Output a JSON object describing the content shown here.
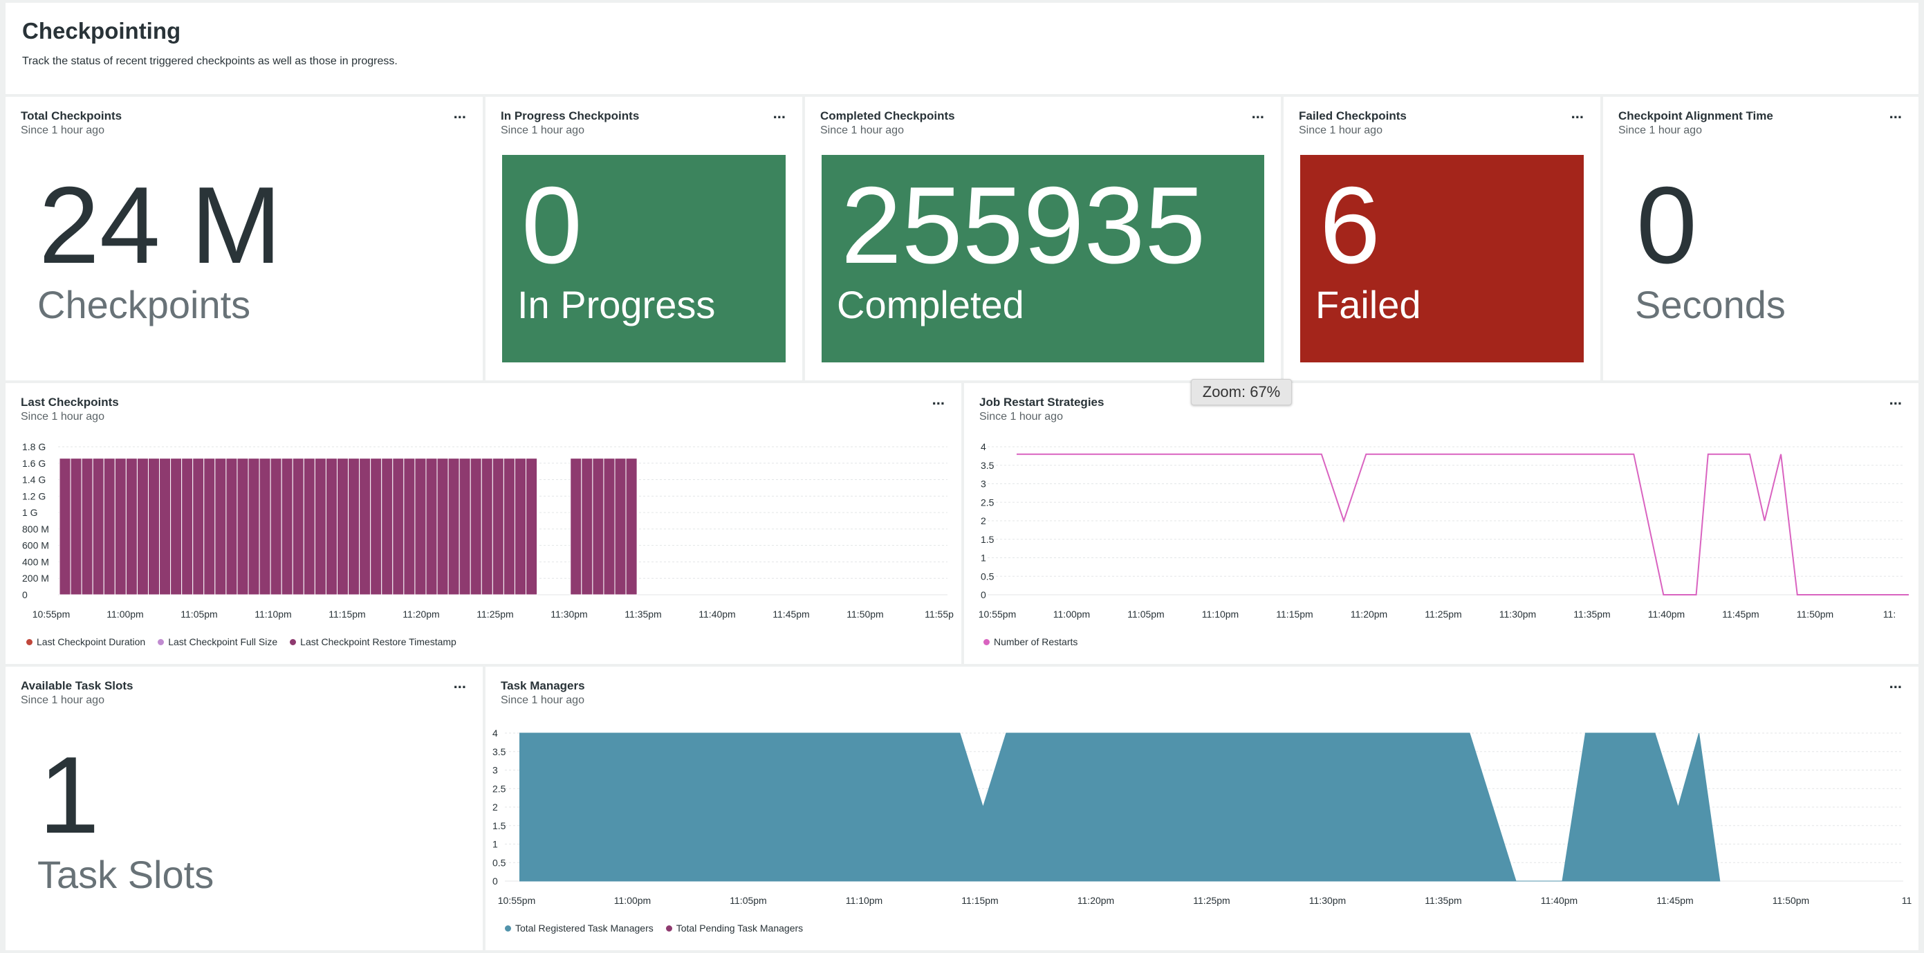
{
  "page": {
    "title": "Checkpointing",
    "description": "Track the status of recent triggered checkpoints as well as those in progress."
  },
  "widgets": {
    "total": {
      "title": "Total Checkpoints",
      "subtitle": "Since 1 hour ago",
      "value": "24 M",
      "label": "Checkpoints"
    },
    "in_progress": {
      "title": "In Progress Checkpoints",
      "subtitle": "Since 1 hour ago",
      "value": "0",
      "label": "In Progress"
    },
    "completed": {
      "title": "Completed Checkpoints",
      "subtitle": "Since 1 hour ago",
      "value": "255935",
      "label": "Completed"
    },
    "failed": {
      "title": "Failed Checkpoints",
      "subtitle": "Since 1 hour ago",
      "value": "6",
      "label": "Failed"
    },
    "alignment": {
      "title": "Checkpoint Alignment Time",
      "subtitle": "Since 1 hour ago",
      "value": "0",
      "label": "Seconds"
    },
    "last_checkpoints": {
      "title": "Last Checkpoints",
      "subtitle": "Since 1 hour ago"
    },
    "restart": {
      "title": "Job Restart Strategies",
      "subtitle": "Since 1 hour ago"
    },
    "task_slots": {
      "title": "Available Task Slots",
      "subtitle": "Since 1 hour ago",
      "value": "1",
      "label": "Task Slots"
    },
    "task_managers": {
      "title": "Task Managers",
      "subtitle": "Since 1 hour ago"
    }
  },
  "menu_label": "...",
  "zoom_badge": "Zoom: 67%",
  "colors": {
    "green": "#3c845d",
    "red": "#a4251b",
    "bar": "#8e3a6f",
    "restart_line": "#d963c0",
    "area": "#5193ab"
  },
  "chart_data": [
    {
      "type": "bar",
      "id": "last_checkpoints",
      "x_ticks": [
        "10:55pm",
        "11:00pm",
        "11:05pm",
        "11:10pm",
        "11:15pm",
        "11:20pm",
        "11:25pm",
        "11:30pm",
        "11:35pm",
        "11:40pm",
        "11:45pm",
        "11:50pm",
        "11:55p"
      ],
      "y_ticks": [
        "0",
        "200 M",
        "400 M",
        "600 M",
        "800 M",
        "1 G",
        "1.2 G",
        "1.4 G",
        "1.6 G",
        "1.8 G"
      ],
      "ylim": [
        0,
        1.8
      ],
      "y_unit": "G",
      "bar_value": 1.66,
      "bar_segments": [
        {
          "start_index": 0,
          "count": 43
        },
        {
          "start_index": 46,
          "count": 6
        }
      ],
      "bar_slots_total": 60,
      "series": [
        {
          "name": "Last Checkpoint Duration",
          "color": "#c0473b"
        },
        {
          "name": "Last Checkpoint Full Size",
          "color": "#c08bd0"
        },
        {
          "name": "Last Checkpoint Restore Timestamp",
          "color": "#8e3a6f"
        }
      ]
    },
    {
      "type": "line",
      "id": "restart",
      "x_ticks": [
        "10:55pm",
        "11:00pm",
        "11:05pm",
        "11:10pm",
        "11:15pm",
        "11:20pm",
        "11:25pm",
        "11:30pm",
        "11:35pm",
        "11:40pm",
        "11:45pm",
        "11:50pm",
        "11:"
      ],
      "y_ticks": [
        "0",
        "0.5",
        "1",
        "1.5",
        "2",
        "2.5",
        "3",
        "3.5",
        "4"
      ],
      "ylim": [
        0,
        4
      ],
      "series": [
        {
          "name": "Number of Restarts",
          "color": "#d963c0",
          "points": [
            [
              0,
              3.8
            ],
            [
              20.5,
              3.8
            ],
            [
              22,
              2
            ],
            [
              23.5,
              3.8
            ],
            [
              41.5,
              3.8
            ],
            [
              43.5,
              0
            ],
            [
              45.7,
              0
            ],
            [
              46.5,
              3.8
            ],
            [
              49.3,
              3.8
            ],
            [
              50.3,
              2
            ],
            [
              51.4,
              3.8
            ],
            [
              52.5,
              0
            ],
            [
              60,
              0
            ]
          ],
          "x_unit": "minutes since 10:55pm"
        }
      ]
    },
    {
      "type": "area",
      "id": "task_managers",
      "x_ticks": [
        "10:55pm",
        "11:00pm",
        "11:05pm",
        "11:10pm",
        "11:15pm",
        "11:20pm",
        "11:25pm",
        "11:30pm",
        "11:35pm",
        "11:40pm",
        "11:45pm",
        "11:50pm",
        "11"
      ],
      "y_ticks": [
        "0",
        "0.5",
        "1",
        "1.5",
        "2",
        "2.5",
        "3",
        "3.5",
        "4"
      ],
      "ylim": [
        0,
        4
      ],
      "series": [
        {
          "name": "Total Registered Task Managers",
          "color": "#5193ab",
          "points": [
            [
              0.7,
              0
            ],
            [
              0.7,
              4
            ],
            [
              19.7,
              4
            ],
            [
              20.7,
              2
            ],
            [
              21.7,
              4
            ],
            [
              41.7,
              4
            ],
            [
              43.7,
              0
            ],
            [
              45.7,
              0
            ],
            [
              46.7,
              4
            ],
            [
              49.7,
              4
            ],
            [
              50.7,
              2
            ],
            [
              51.6,
              4
            ],
            [
              52.5,
              0
            ]
          ],
          "x_unit": "minutes since 10:55pm"
        },
        {
          "name": "Total Pending Task Managers",
          "color": "#8e3a6f",
          "points": []
        }
      ]
    }
  ]
}
